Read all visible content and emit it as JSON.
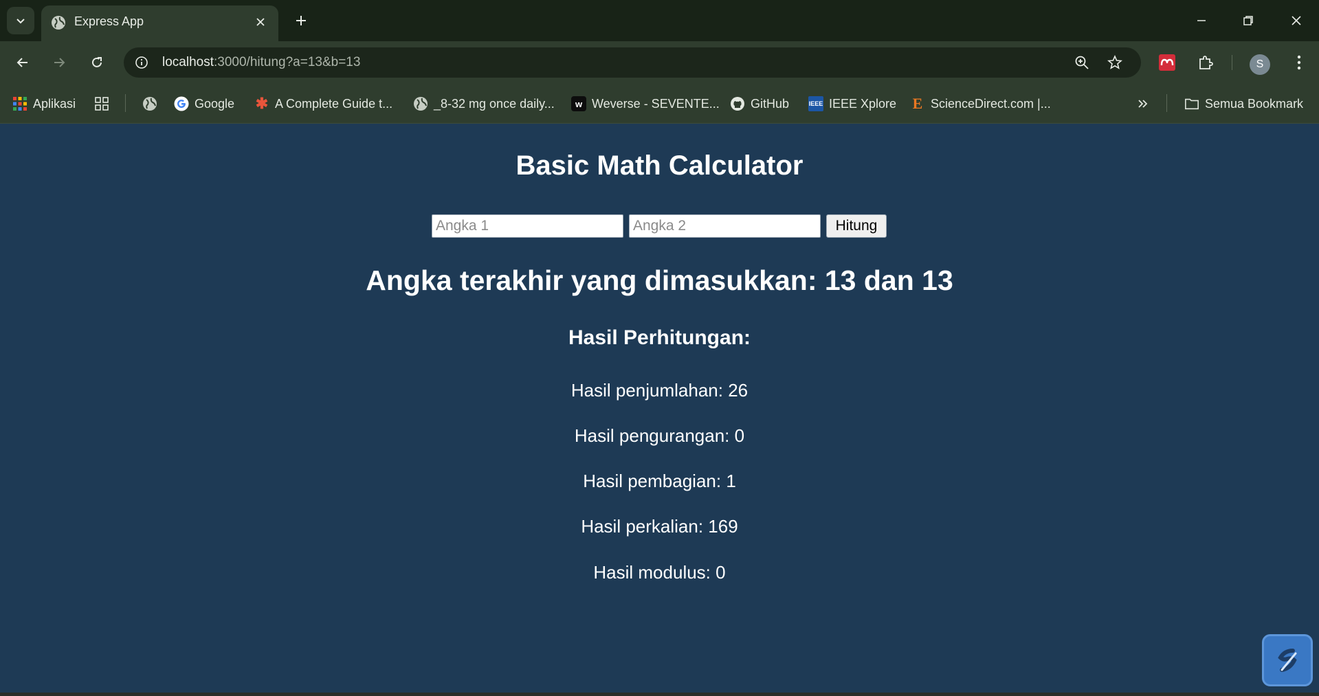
{
  "browser": {
    "tab_title": "Express App",
    "url_host": "localhost",
    "url_rest": ":3000/hitung?a=13&b=13",
    "avatar_letter": "S",
    "accent": "#2f3d2e"
  },
  "bookmarks": {
    "items": [
      {
        "label": "Aplikasi",
        "icon": "apps-grid-icon"
      },
      {
        "label": "Google",
        "icon": "google-icon"
      },
      {
        "label": "A Complete Guide t...",
        "icon": "asterisk-icon"
      },
      {
        "label": "_8-32 mg once daily...",
        "icon": "globe-icon"
      },
      {
        "label": "Weverse - SEVENTE...",
        "icon": "weverse-icon"
      },
      {
        "label": "GitHub",
        "icon": "github-icon"
      },
      {
        "label": "IEEE Xplore",
        "icon": "ieee-icon"
      },
      {
        "label": "ScienceDirect.com |...",
        "icon": "sciencedirect-icon"
      }
    ],
    "all_bookmarks": "Semua Bookmark"
  },
  "page": {
    "title": "Basic Math Calculator",
    "input1_placeholder": "Angka 1",
    "input2_placeholder": "Angka 2",
    "submit_label": "Hitung",
    "last_entered": "Angka terakhir yang dimasukkan: 13 dan 13",
    "results_heading": "Hasil Perhitungan:",
    "results": [
      "Hasil penjumlahan: 26",
      "Hasil pengurangan: 0",
      "Hasil pembagian: 1",
      "Hasil perkalian: 169",
      "Hasil modulus: 0"
    ],
    "background": "#1e3a55"
  }
}
